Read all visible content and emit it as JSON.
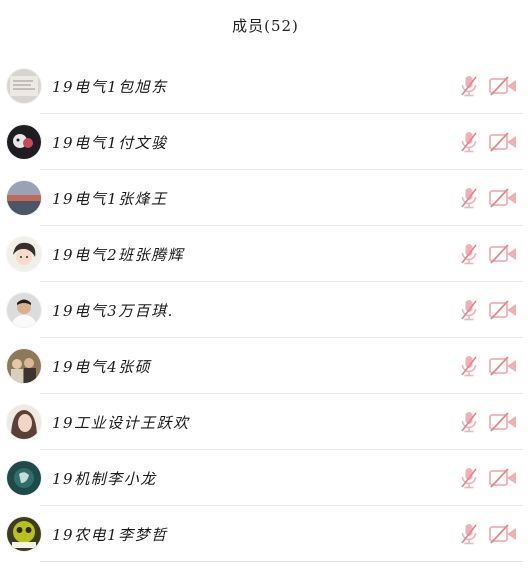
{
  "header": {
    "title": "成员(52)"
  },
  "members": [
    {
      "name": "19电气1包旭东",
      "avatar": "paper-photo"
    },
    {
      "name": "19电气1付文骏",
      "avatar": "dark-cartoon"
    },
    {
      "name": "19电气1张烽王",
      "avatar": "sunset-landscape"
    },
    {
      "name": "19电气2班张腾辉",
      "avatar": "anime-boy"
    },
    {
      "name": "19电气3万百琪.",
      "avatar": "man-white-shirt"
    },
    {
      "name": "19电气4张硕",
      "avatar": "group-photo"
    },
    {
      "name": "19工业设计王跃欢",
      "avatar": "girl-portrait"
    },
    {
      "name": "19机制李小龙",
      "avatar": "teal-abstract"
    },
    {
      "name": "19农电1李梦哲",
      "avatar": "green-emoji-badge"
    }
  ],
  "colors": {
    "muted_icon": "#f1b0b3",
    "muted_slash": "#d9898f",
    "divider": "#e8e8e8"
  },
  "icons": {
    "mic": "mic-muted-icon",
    "camera": "camera-off-icon"
  }
}
